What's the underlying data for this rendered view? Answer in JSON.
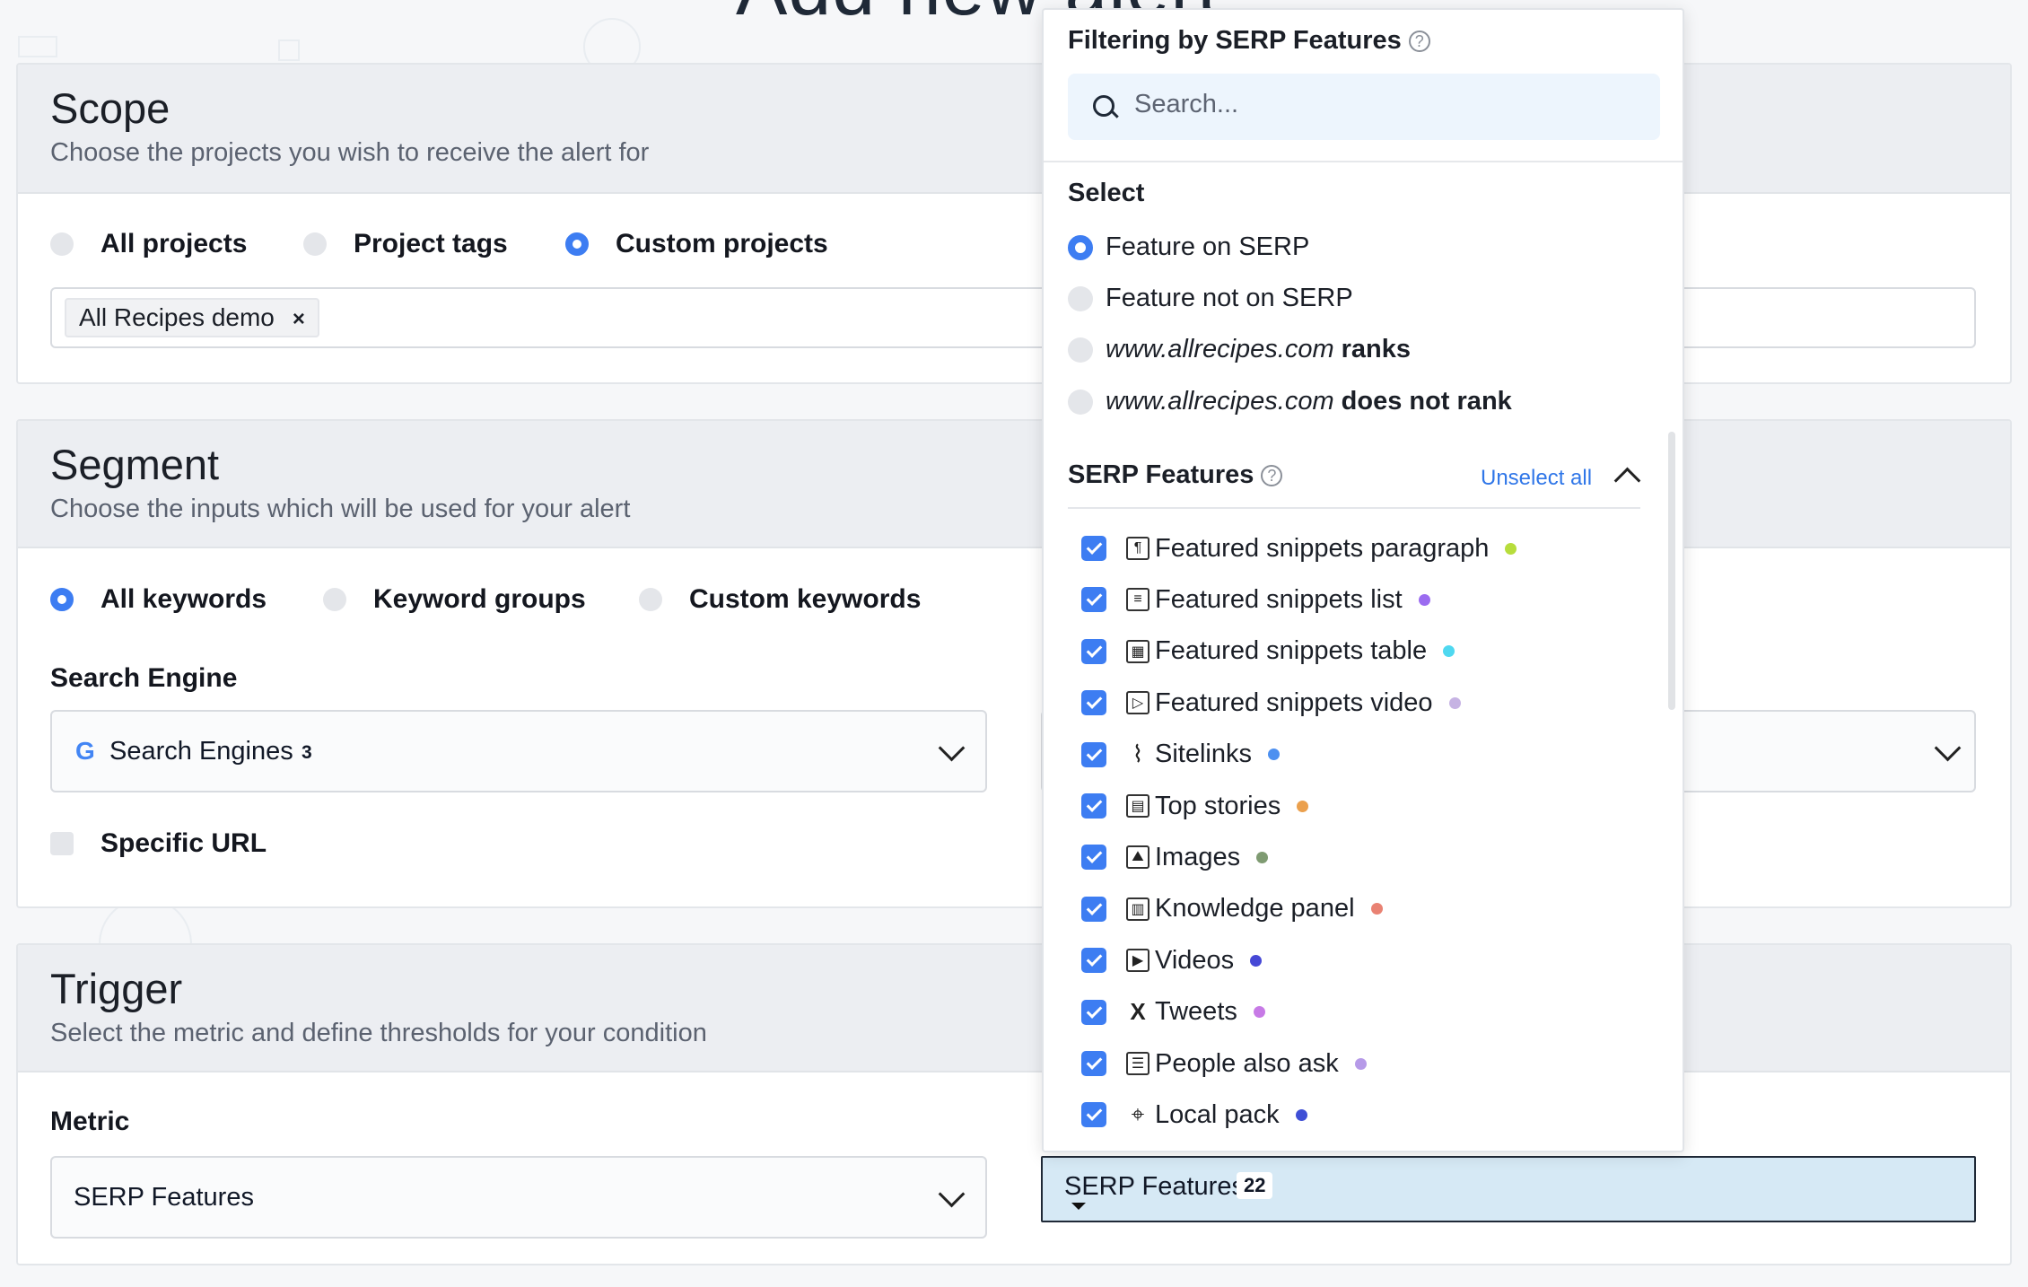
{
  "page": {
    "heading": "Add new alert"
  },
  "scope": {
    "title": "Scope",
    "subtitle": "Choose the projects you wish to receive the alert for",
    "options": [
      "All projects",
      "Project tags",
      "Custom projects"
    ],
    "selected": "Custom projects",
    "tag": "All Recipes demo",
    "tag_remove": "×"
  },
  "segment": {
    "title": "Segment",
    "subtitle": "Choose the inputs which will be used for your alert",
    "options": [
      "All keywords",
      "Keyword groups",
      "Custom keywords"
    ],
    "selected": "All keywords",
    "search_engine_label": "Search Engine",
    "search_engine_value": "Search Engines",
    "search_engine_count": "3",
    "search_engine_icon": "G",
    "specific_url_label": "Specific URL"
  },
  "trigger": {
    "title": "Trigger",
    "subtitle": "Select the metric and define thresholds for your condition",
    "metric_label": "Metric",
    "metric_value": "SERP Features",
    "serp_button_label": "SERP Features",
    "serp_button_count": "22"
  },
  "dropdown": {
    "title": "Filtering by SERP Features",
    "search_placeholder": "Search...",
    "select_label": "Select",
    "select_options": [
      {
        "text": "Feature on SERP",
        "selected": true
      },
      {
        "text": "Feature not on SERP",
        "selected": false
      },
      {
        "domain": "www.allrecipes.com",
        "suffix": "ranks",
        "selected": false
      },
      {
        "domain": "www.allrecipes.com",
        "suffix": "does not rank",
        "selected": false
      }
    ],
    "features_heading": "SERP Features",
    "unselect_all": "Unselect all",
    "features": [
      {
        "label": "Featured snippets paragraph",
        "icon": "snippet-paragraph-icon",
        "color": "#b7dd3c",
        "checked": true
      },
      {
        "label": "Featured snippets list",
        "icon": "snippet-list-icon",
        "color": "#9b6cf0",
        "checked": true
      },
      {
        "label": "Featured snippets table",
        "icon": "snippet-table-icon",
        "color": "#4fd8f0",
        "checked": true
      },
      {
        "label": "Featured snippets video",
        "icon": "snippet-video-icon",
        "color": "#c6b3e3",
        "checked": true
      },
      {
        "label": "Sitelinks",
        "icon": "paperclip-icon",
        "color": "#4d90f0",
        "checked": true
      },
      {
        "label": "Top stories",
        "icon": "newspaper-icon",
        "color": "#eba04d",
        "checked": true
      },
      {
        "label": "Images",
        "icon": "image-icon",
        "color": "#7f9b72",
        "checked": true
      },
      {
        "label": "Knowledge panel",
        "icon": "book-icon",
        "color": "#e98273",
        "checked": true
      },
      {
        "label": "Videos",
        "icon": "video-icon",
        "color": "#4648d6",
        "checked": true
      },
      {
        "label": "Tweets",
        "icon": "x-icon",
        "color": "#c77ae6",
        "checked": true
      },
      {
        "label": "People also ask",
        "icon": "chat-icon",
        "color": "#b69ae8",
        "checked": true
      },
      {
        "label": "Local pack",
        "icon": "map-pin-icon",
        "color": "#3f4fd6",
        "checked": true
      }
    ]
  },
  "colors": {
    "accent": "#3d7df2",
    "link": "#2f76e8",
    "highlight": "#d6e9f5"
  }
}
